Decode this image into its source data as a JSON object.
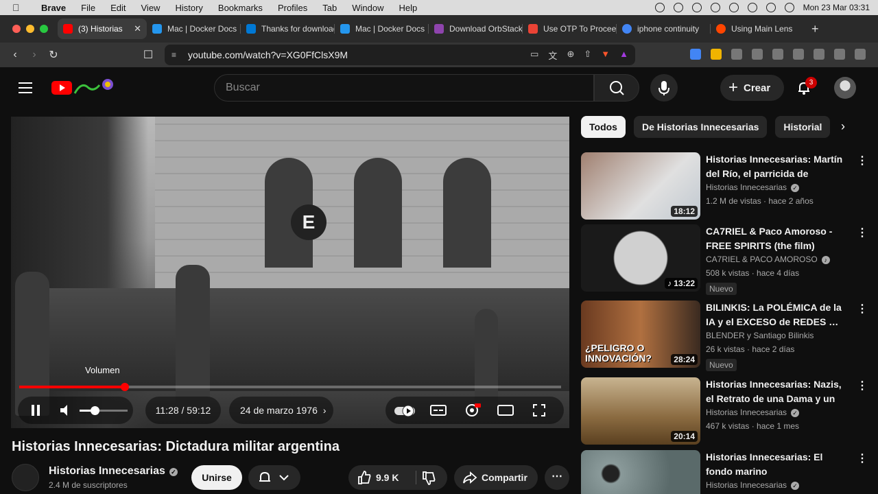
{
  "menubar": {
    "app": "Brave",
    "items": [
      "File",
      "Edit",
      "View",
      "History",
      "Bookmarks",
      "Profiles",
      "Tab",
      "Window",
      "Help"
    ],
    "clock": "Mon 23 Mar  03:31"
  },
  "tabs": [
    {
      "label": "(3) Historias",
      "active": true,
      "favicon_color": "#ff0000"
    },
    {
      "label": "Mac | Docker Docs",
      "active": false,
      "favicon_color": "#2496ed"
    },
    {
      "label": "Thanks for downloading",
      "active": false,
      "favicon_color": "#0078d4"
    },
    {
      "label": "Mac | Docker Docs",
      "active": false,
      "favicon_color": "#2496ed"
    },
    {
      "label": "Download OrbStack",
      "active": false,
      "favicon_color": "#8e44ad"
    },
    {
      "label": "Use OTP To Proceed",
      "active": false,
      "favicon_color": "#ea4335"
    },
    {
      "label": "iphone continuity",
      "active": false,
      "favicon_color": "#4285f4"
    },
    {
      "label": "Using Main Lens",
      "active": false,
      "favicon_color": "#ff4500"
    }
  ],
  "address": {
    "url": "youtube.com/watch?v=XG0FfClsX9M"
  },
  "youtube": {
    "search_placeholder": "Buscar",
    "create_label": "Crear",
    "notifications_count": "3",
    "chips": [
      "Todos",
      "De Historias Innecesarias",
      "Historial"
    ],
    "player": {
      "volume_tooltip": "Volumen",
      "time": "11:28 / 59:12",
      "chapter": "24 de marzo 1976",
      "progress_fraction": 0.194
    },
    "video": {
      "title": "Historias Innecesarias: Dictadura militar argentina",
      "channel": "Historias Innecesarias",
      "subscribers": "2.4 M de suscriptores",
      "join_label": "Unirse",
      "likes": "9.9 K",
      "share_label": "Compartir"
    },
    "recommendations": [
      {
        "title": "Historias Innecesarias: Martín del Río, el parricida de Vicente…",
        "channel": "Historias Innecesarias",
        "meta": "1.2 M de vistas · hace 2 años",
        "duration": "18:12",
        "badge": "",
        "thumb_color": "#6b6b6b"
      },
      {
        "title": "CA7RIEL & Paco Amoroso - FREE SPIRITS (the film)",
        "channel": "CA7RIEL & PACO AMOROSO",
        "meta": "508 k vistas · hace 4 días",
        "duration": "13:22",
        "badge": "Nuevo",
        "thumb_color": "#3a3a3a"
      },
      {
        "title": "BILINKIS: La POLÉMICA de la IA y el EXCESO de REDES …",
        "channel": "BLENDER  y Santiago Bilinkis",
        "meta": "26 k vistas · hace 2 días",
        "duration": "28:24",
        "badge": "Nuevo",
        "thumb_color": "#8a5a2a"
      },
      {
        "title": "Historias Innecesarias: Nazis, el Retrato de una Dama y un avis…",
        "channel": "Historias Innecesarias",
        "meta": "467 k vistas · hace 1 mes",
        "duration": "20:14",
        "badge": "",
        "thumb_color": "#9a7a4a"
      },
      {
        "title": "Historias Innecesarias: El fondo marino",
        "channel": "Historias Innecesarias",
        "meta": "",
        "duration": "",
        "badge": "",
        "thumb_color": "#7a8a8a"
      }
    ]
  }
}
